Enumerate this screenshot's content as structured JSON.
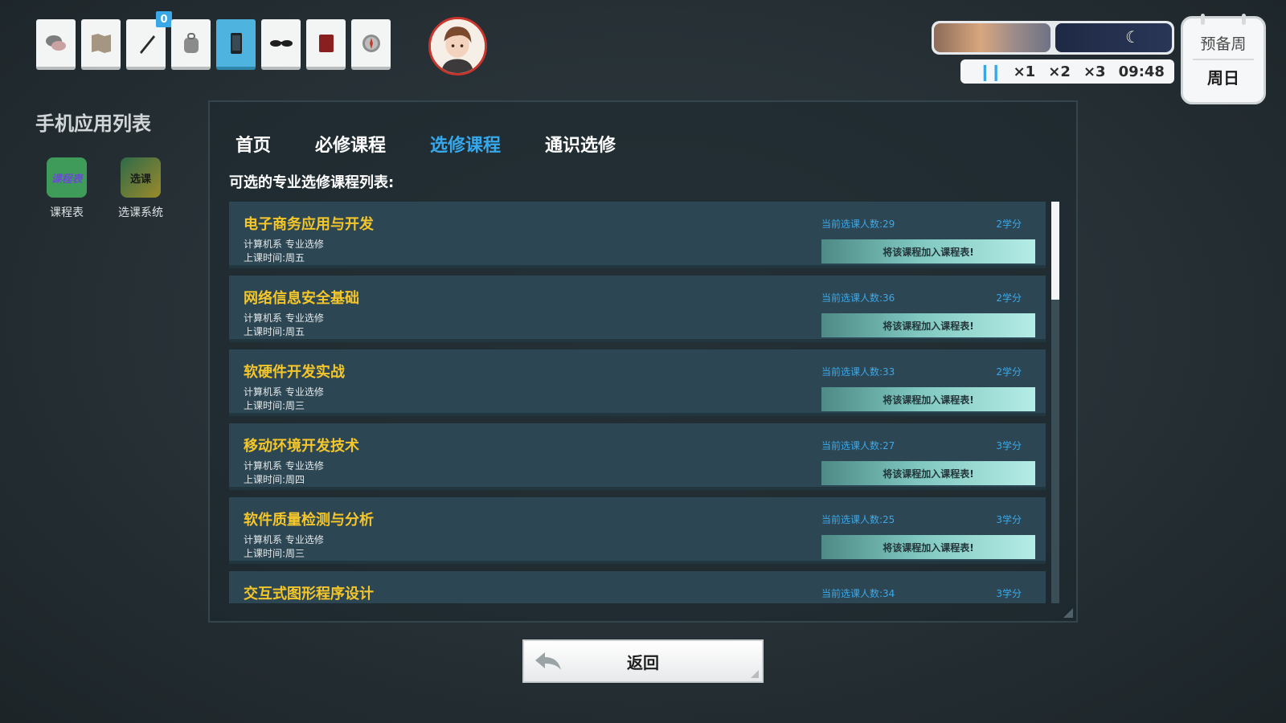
{
  "toolbar": {
    "items": [
      {
        "icon": "chat-bubbles-icon"
      },
      {
        "icon": "map-icon"
      },
      {
        "icon": "pen-icon",
        "badge": "0"
      },
      {
        "icon": "backpack-icon"
      },
      {
        "icon": "phone-icon",
        "active": true
      },
      {
        "icon": "sunglasses-icon"
      },
      {
        "icon": "book-icon"
      },
      {
        "icon": "compass-icon"
      }
    ]
  },
  "time": {
    "speeds": [
      "×1",
      "×2",
      "×3"
    ],
    "clock": "09:48",
    "week": "预备周",
    "day": "周日"
  },
  "sidebar": {
    "title": "手机应用列表",
    "apps": [
      {
        "icon_text": "课程表",
        "label": "课程表",
        "color": "#3e9b5a"
      },
      {
        "icon_text": "选课",
        "label": "选课系统",
        "color": "#3f6a3d"
      }
    ]
  },
  "tabs": [
    {
      "label": "首页"
    },
    {
      "label": "必修课程"
    },
    {
      "label": "选修课程",
      "active": true
    },
    {
      "label": "通识选修"
    }
  ],
  "list_title": "可选的专业选修课程列表:",
  "courses": [
    {
      "name": "电子商务应用与开发",
      "dept": "计算机系 专业选修",
      "time": "上课时间:周五",
      "count": "当前选课人数:29",
      "credit": "2学分",
      "button": "将该课程加入课程表!"
    },
    {
      "name": "网络信息安全基础",
      "dept": "计算机系 专业选修",
      "time": "上课时间:周五",
      "count": "当前选课人数:36",
      "credit": "2学分",
      "button": "将该课程加入课程表!"
    },
    {
      "name": "软硬件开发实战",
      "dept": "计算机系 专业选修",
      "time": "上课时间:周三",
      "count": "当前选课人数:33",
      "credit": "2学分",
      "button": "将该课程加入课程表!"
    },
    {
      "name": "移动环境开发技术",
      "dept": "计算机系 专业选修",
      "time": "上课时间:周四",
      "count": "当前选课人数:27",
      "credit": "3学分",
      "button": "将该课程加入课程表!"
    },
    {
      "name": "软件质量检测与分析",
      "dept": "计算机系 专业选修",
      "time": "上课时间:周三",
      "count": "当前选课人数:25",
      "credit": "3学分",
      "button": "将该课程加入课程表!"
    },
    {
      "name": "交互式图形程序设计",
      "dept": "",
      "time": "",
      "count": "当前选课人数:34",
      "credit": "3学分",
      "button": ""
    }
  ],
  "back_label": "返回",
  "colors": {
    "accent": "#36a8ec",
    "course_name": "#f4c62a",
    "card": "#2c4654"
  }
}
